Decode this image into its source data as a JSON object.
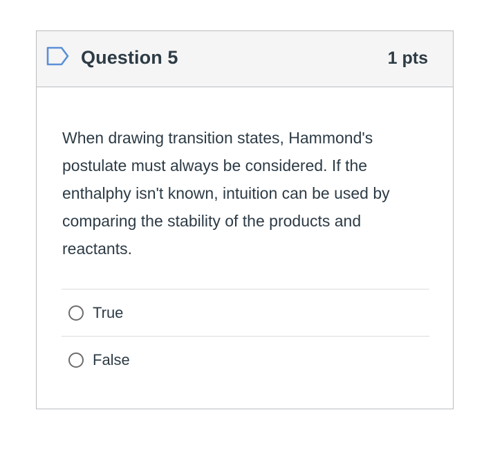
{
  "question": {
    "title": "Question 5",
    "points": "1 pts",
    "flag_icon": "flag-outline-icon",
    "text": "When drawing transition states, Hammond's postulate must always be considered. If the enthalphy isn't known, intuition can be used by comparing the stability of the products and reactants.",
    "answers": [
      {
        "label": "True",
        "selected": false
      },
      {
        "label": "False",
        "selected": false
      }
    ]
  },
  "colors": {
    "text": "#2d3b45",
    "header_bg": "#f5f5f5",
    "border": "#b9bcbf",
    "flag": "#5a8fd8"
  }
}
